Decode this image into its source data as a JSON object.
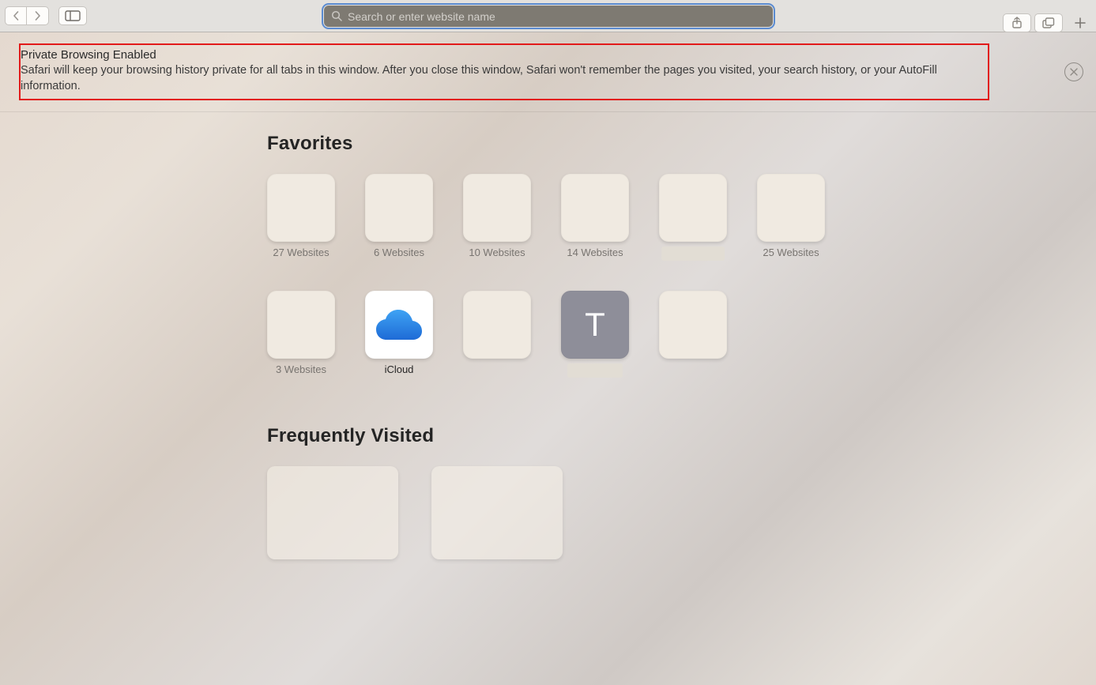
{
  "toolbar": {
    "search_placeholder": "Search or enter website name"
  },
  "notice": {
    "title": "Private Browsing Enabled",
    "body": "Safari will keep your browsing history private for all tabs in this window. After you close this window, Safari won't remember the pages you visited, your search history, or your AutoFill information."
  },
  "sections": {
    "favorites_title": "Favorites",
    "frequent_title": "Frequently Visited"
  },
  "favorites": [
    {
      "label": "27 Websites",
      "style": "plain"
    },
    {
      "label": "6 Websites",
      "style": "plain"
    },
    {
      "label": "10 Websites",
      "style": "plain"
    },
    {
      "label": "14 Websites",
      "style": "plain"
    },
    {
      "label": "15 Websites",
      "style": "redacted"
    },
    {
      "label": "25 Websites",
      "style": "plain"
    },
    {
      "label": "3 Websites",
      "style": "plain"
    },
    {
      "label": "iCloud",
      "style": "icloud"
    },
    {
      "label": "",
      "style": "blank"
    },
    {
      "label": "T",
      "style": "letter"
    },
    {
      "label": "",
      "style": "blank"
    }
  ],
  "frequent_count": 2
}
